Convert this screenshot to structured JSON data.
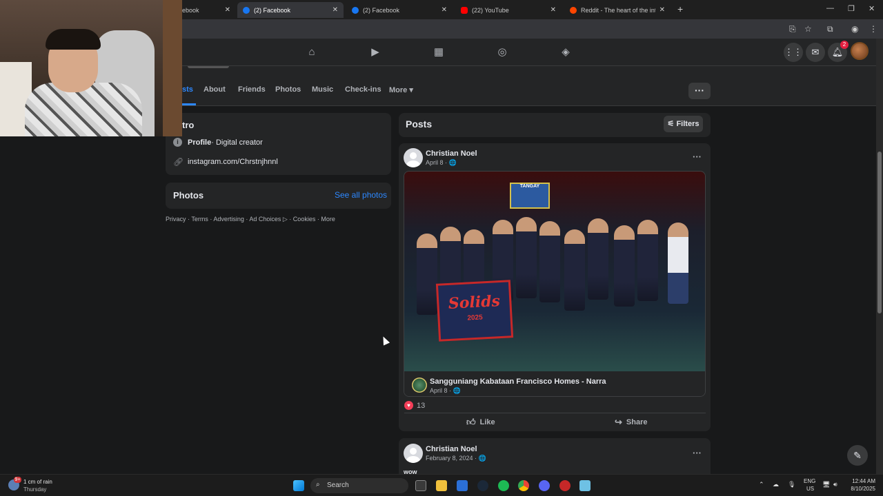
{
  "browser": {
    "tabs": [
      {
        "title": "ebook",
        "color": "#1877f2",
        "active": false
      },
      {
        "title": "(2) Facebook",
        "color": "#1877f2",
        "active": true
      },
      {
        "title": "(2) Facebook",
        "color": "#1877f2",
        "active": false
      },
      {
        "title": "(22) YouTube",
        "color": "#ff0000",
        "active": false
      },
      {
        "title": "Reddit - The heart of the intern",
        "color": "#ff4500",
        "active": false
      }
    ],
    "new_tab": "+",
    "controls": {
      "minimize": "—",
      "maximize": "❐",
      "close": "✕"
    }
  },
  "fb_nav": {
    "notification_count": "2"
  },
  "profile_tabs": {
    "items": [
      "sts",
      "About",
      "Friends",
      "Photos",
      "Music",
      "Check-ins",
      "More ▾"
    ],
    "more_dots": "···"
  },
  "intro": {
    "heading": "tro",
    "category_label": "Profile",
    "category_value": " · Digital creator",
    "link": "instagram.com/Chrstnjhnnl"
  },
  "photos_card": {
    "heading": "Photos",
    "see_all": "See all photos"
  },
  "footer": {
    "links": "Privacy · Terms · Advertising · Ad Choices ▷ · Cookies · More"
  },
  "posts": {
    "heading": "Posts",
    "filters_label": "Filters",
    "post1": {
      "author": "Christian Noel",
      "date": "April 8 · 🌐",
      "shared": {
        "banner_text": "TANGAY",
        "sign_title": "Solids",
        "sign_year": "2025",
        "org": "Sangguniang Kabataan Francisco Homes - Narra",
        "date": "April 8 · 🌐"
      },
      "reactions": "13",
      "like": "Like",
      "share": "Share"
    },
    "post2": {
      "author": "Christian Noel",
      "date": "February 8, 2024 · 🌐",
      "text": "wow"
    }
  },
  "taskbar": {
    "weather_badge": "9+",
    "weather_line1": "1 cm of rain",
    "weather_line2": "Thursday",
    "search_placeholder": "Search",
    "lang1": "ENG",
    "lang2": "US",
    "time": "12:44 AM",
    "date": "8/10/2025"
  }
}
